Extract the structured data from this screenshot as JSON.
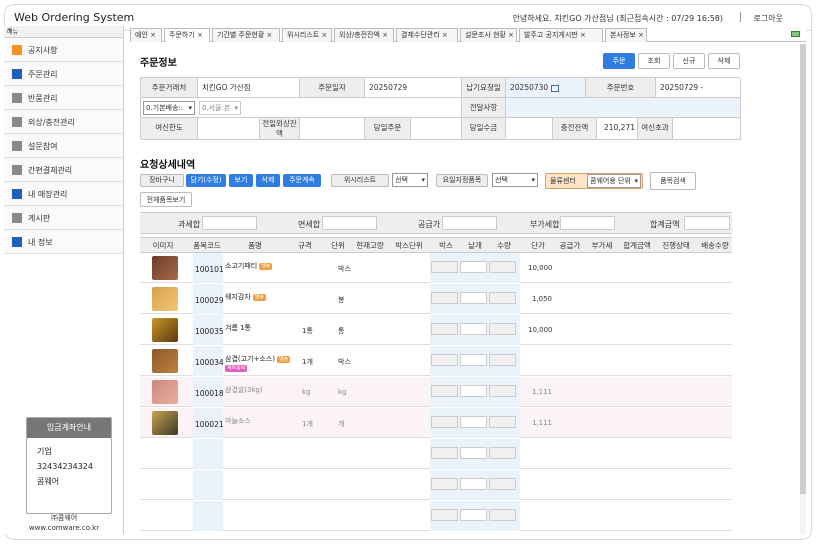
{
  "app": {
    "title": "Web Ordering System",
    "greeting": "안녕하세요. 치킨GO 가산점님 (최근접속시간 : 07/29 16:58)",
    "logout": "로그아웃"
  },
  "sidebar": {
    "header": "메뉴",
    "collapse": "«",
    "items": [
      {
        "label": "공지사항",
        "color": "#f7931e"
      },
      {
        "label": "주문관리",
        "color": "#1f5fbf"
      },
      {
        "label": "반품관리",
        "color": "#8a8a8a"
      },
      {
        "label": "외상/충전관리",
        "color": "#8a8a8a"
      },
      {
        "label": "설문참여",
        "color": "#8a8a8a"
      },
      {
        "label": "간편결제관리",
        "color": "#8a8a8a"
      },
      {
        "label": "내 매장관리",
        "color": "#1f5fbf"
      },
      {
        "label": "게시판",
        "color": "#8a8a8a"
      },
      {
        "label": "내 정보",
        "color": "#1f5fbf"
      }
    ],
    "deposit": {
      "title": "입금계좌안내",
      "lines": [
        "기업",
        "32434234324",
        "콤웨어"
      ]
    },
    "company": {
      "name": "㈜콤웨어",
      "url": "www.comware.co.kr"
    }
  },
  "tabs": [
    "예인 ×",
    "주문하기 ×",
    "기간별 주문현황 ×",
    "위시리스트 ×",
    "외상/충전잔액 ×",
    "결제수단관리 ×",
    "설문조사 현황 ×",
    "발주고 공지게시판 ×",
    "본사정보 ×"
  ],
  "order": {
    "title": "주문정보",
    "buttons": [
      "주문",
      "조회",
      "신규",
      "삭제"
    ],
    "labels": {
      "customer": "주문거래처",
      "order_date": "주문일자",
      "delivery_date": "납기요청일",
      "order_no": "주문번호",
      "transfer": "전달사항",
      "credit_limit": "여신한도",
      "prev_balance": "전일외상잔액",
      "today_order": "당일주문",
      "today_collect": "당일수금",
      "charge_balance": "충전잔액",
      "credit_over": "여신초과"
    },
    "values": {
      "customer": "치킨GO 가산점",
      "order_date": "20250729",
      "delivery_date": "20250730",
      "order_no": "20250729 -",
      "delivery_type": "0.기본배송::",
      "warehouse": "0.서울:본",
      "charge_balance": "210,271"
    }
  },
  "detail": {
    "title": "요청상세내역",
    "cart_label": "장바구니",
    "cart_buttons": [
      "담기(수정)",
      "보기",
      "삭제",
      "주문계속"
    ],
    "wishlist_label": "위시리스트",
    "wishlist_value": "선택",
    "day_label": "요일지정품목",
    "day_value": "선택",
    "logistics_label": "물류센터",
    "logistics_value": "콤웨어용 단위",
    "search_button": "품목검색",
    "all_button": "전체품목보기",
    "summary": [
      "과세합",
      "면세합",
      "공급가",
      "부가세합",
      "합계금액"
    ],
    "columns": [
      "이미지",
      "품목코드",
      "품명",
      "규격",
      "단위",
      "현재고량",
      "박스단위",
      "박스",
      "낱개",
      "수량",
      "단가",
      "공급가",
      "부가세",
      "합계금액",
      "진행상태",
      "배송수량"
    ],
    "rows": [
      {
        "code": "100101",
        "name": "소고기패티",
        "tag": "냉동",
        "tag2": "",
        "spec": "",
        "unit": "박스",
        "price": "10,000",
        "img": "#6a3b2a",
        "img2": "#a86b4a"
      },
      {
        "code": "100029",
        "name": "웨지감자",
        "tag": "냉동",
        "tag2": "",
        "spec": "",
        "unit": "봉",
        "price": "1,050",
        "img": "#d9a04a",
        "img2": "#f0c878"
      },
      {
        "code": "100035",
        "name": "겨름 1통",
        "tag": "",
        "tag2": "",
        "spec": "1통",
        "unit": "통",
        "price": "10,000",
        "img": "#c9962a",
        "img2": "#5a3a10"
      },
      {
        "code": "100034",
        "name": "삼겹(고기+소스)",
        "tag": "냉동",
        "tag2": "세트품목",
        "spec": "1개",
        "unit": "박스",
        "price": "",
        "img": "#8a5a2a",
        "img2": "#c08040"
      },
      {
        "code": "100018",
        "name": "삼겹살(3kg)",
        "tag": "",
        "tag2": "",
        "spec": "kg",
        "unit": "kg",
        "price": "1,111",
        "img": "#c88a7a",
        "img2": "#e8b0a0"
      },
      {
        "code": "100021",
        "name": "마늘소스",
        "tag": "",
        "tag2": "",
        "spec": "1개",
        "unit": "개",
        "price": "1,111",
        "img": "#c9a24a",
        "img2": "#3a3a2a"
      }
    ]
  }
}
